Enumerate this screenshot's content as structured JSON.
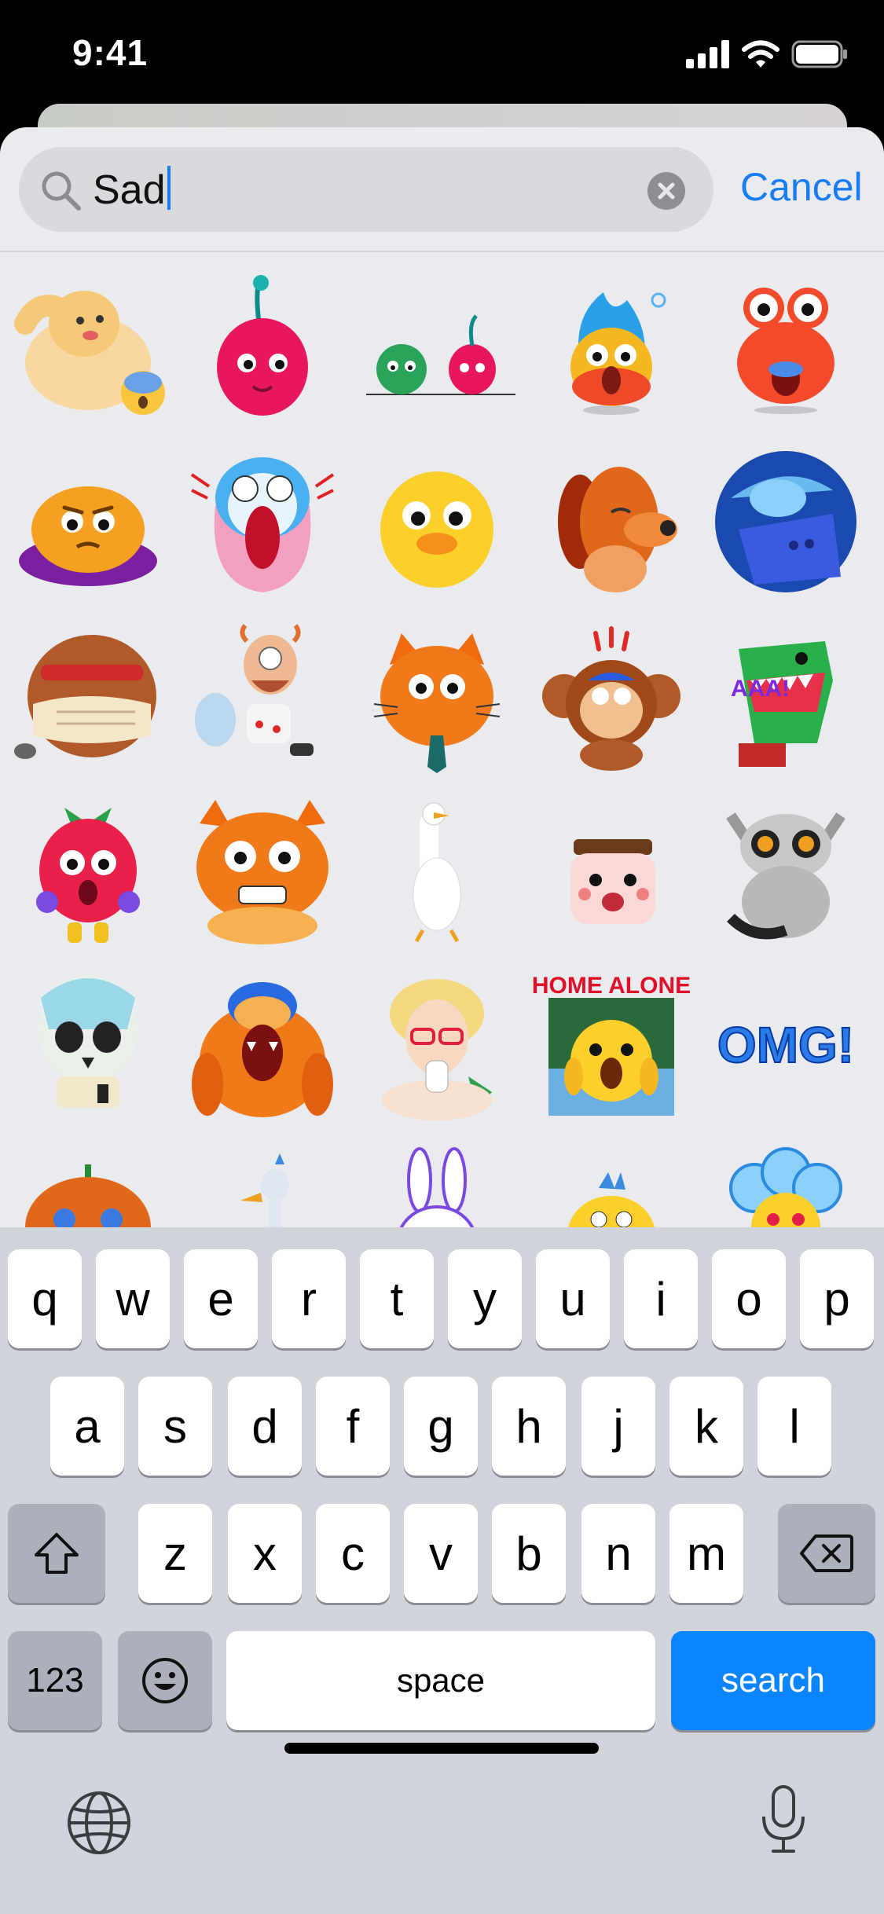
{
  "status_bar": {
    "time": "9:41"
  },
  "search": {
    "query": "Sad",
    "cancel_label": "Cancel"
  },
  "stickers": [
    "muscle-dog",
    "pink-cherry",
    "virus-and-cherry",
    "fire-screaming",
    "crab-shocked",
    "cushion-worried",
    "screaming-face",
    "yellow-duck",
    "sad-dog",
    "blue-cat-sleeping",
    "hidden-hamster",
    "old-man-wings",
    "orange-cat-tie",
    "monkey-shocked",
    "green-dino",
    "strawberry-scared",
    "orange-cat-scared",
    "white-goose",
    "jar-face",
    "lemur-crying",
    "skull",
    "bear-screaming",
    "lady-glasses",
    "home-alone",
    "omg-text",
    "pumpkin",
    "ostrich",
    "bunny",
    "yellow-bird",
    "blue-flower"
  ],
  "sticker_texts": {
    "home_alone": "HOME ALONE",
    "omg": "OMG!",
    "aaa": "AAA!"
  },
  "keyboard": {
    "row1": [
      "q",
      "w",
      "e",
      "r",
      "t",
      "y",
      "u",
      "i",
      "o",
      "p"
    ],
    "row2": [
      "a",
      "s",
      "d",
      "f",
      "g",
      "h",
      "j",
      "k",
      "l"
    ],
    "row3": [
      "z",
      "x",
      "c",
      "v",
      "b",
      "n",
      "m"
    ],
    "numbers_label": "123",
    "space_label": "space",
    "search_label": "search"
  },
  "colors": {
    "accent": "#1a7cf5",
    "search_key": "#0a84ff"
  }
}
